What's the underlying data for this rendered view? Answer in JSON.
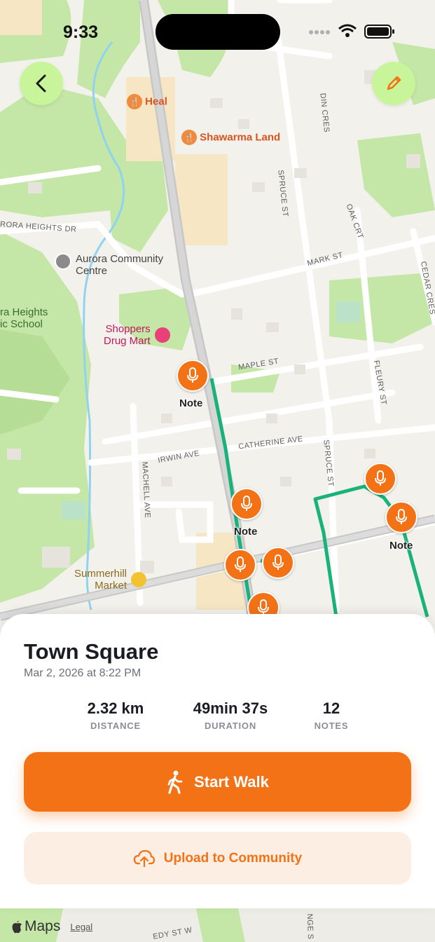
{
  "status_bar": {
    "time": "9:33"
  },
  "map": {
    "places": [
      {
        "id": "heal",
        "label": "Heal",
        "color": "#d9531e"
      },
      {
        "id": "shawarma",
        "label": "Shawarma Land",
        "color": "#d9531e"
      },
      {
        "id": "aurora_cc",
        "line1": "Aurora Community",
        "line2": "Centre",
        "color": "#444444"
      },
      {
        "id": "school",
        "line1": "ra Heights",
        "line2": "ic School",
        "color": "#3b6e2e"
      },
      {
        "id": "shoppers",
        "line1": "Shoppers",
        "line2": "Drug Mart",
        "color": "#c2185b"
      },
      {
        "id": "summerhill",
        "line1": "Summerhill",
        "line2": "Market",
        "color": "#8a6d1e"
      }
    ],
    "streets": {
      "aurora_heights": "RORA HEIGHTS DR",
      "mark": "MARK ST",
      "maple": "MAPLE ST",
      "irwin": "IRWIN AVE",
      "catherine": "CATHERINE AVE",
      "machell": "MACHELL AVE",
      "spruce_top": "SPRUCE ST",
      "spruce_mid": "SPRUCE ST",
      "oak": "OAK CRT",
      "cedar": "CEDAR CRES",
      "fleury": "FLEURY ST",
      "din": "DIN CRES",
      "bottom_left": "EDY ST W",
      "bottom_right": "NGE S"
    },
    "note_label": "Note",
    "route_color": "#19b27a",
    "accent_color": "#f47216"
  },
  "walk": {
    "title": "Town Square",
    "date": "Mar 2, 2026 at 8:22 PM",
    "stats": [
      {
        "value": "2.32 km",
        "label": "DISTANCE"
      },
      {
        "value": "49min 37s",
        "label": "DURATION"
      },
      {
        "value": "12",
        "label": "NOTES"
      }
    ],
    "start_label": "Start Walk",
    "upload_label": "Upload to Community"
  },
  "footer": {
    "maps": "Maps",
    "legal": "Legal"
  }
}
